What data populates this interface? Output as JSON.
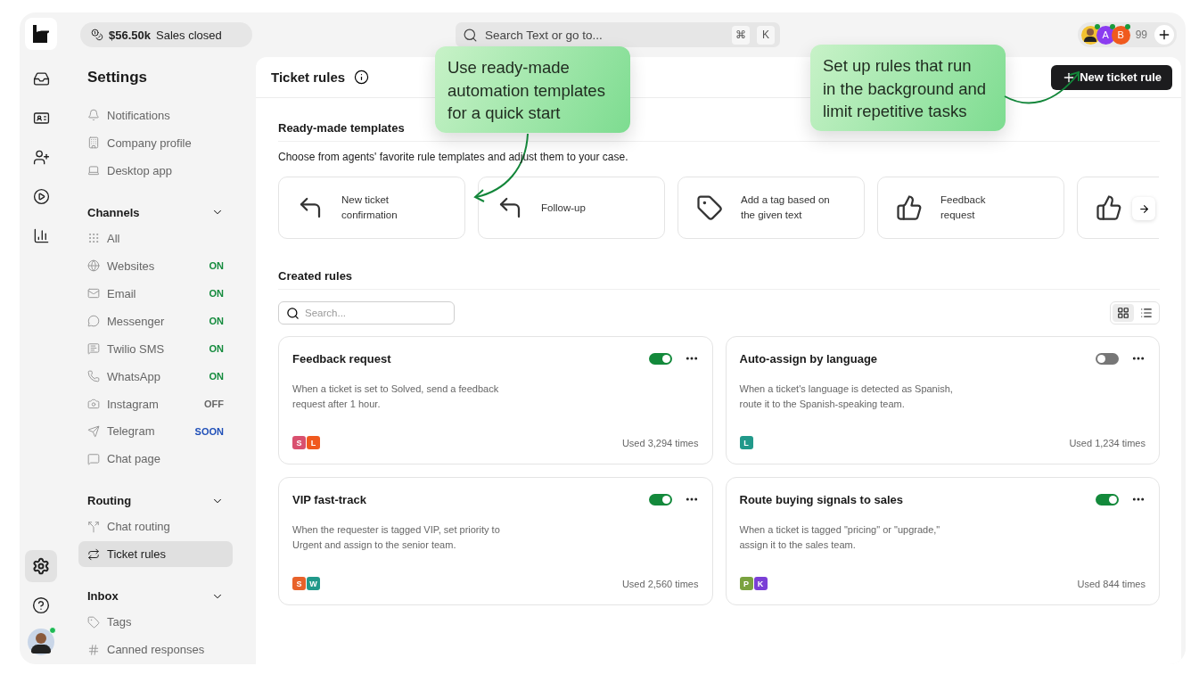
{
  "rail": {
    "items": [
      {
        "kind": "inbox",
        "selected": false
      },
      {
        "kind": "contact",
        "selected": false
      },
      {
        "kind": "team",
        "selected": false
      },
      {
        "kind": "play",
        "selected": false
      },
      {
        "kind": "chart",
        "selected": false
      }
    ],
    "bottom": [
      {
        "kind": "settings",
        "selected": true
      },
      {
        "kind": "help",
        "selected": false
      }
    ],
    "user": {
      "online": true
    }
  },
  "sales": {
    "amount": "$56.50k",
    "label": "Sales closed"
  },
  "search": {
    "placeholder": "Search Text or go to...",
    "keys": [
      "⌘",
      "K"
    ]
  },
  "team": {
    "avatars": [
      {
        "kind": "photo",
        "online": true
      },
      {
        "kind": "letter",
        "letter": "A",
        "color": "#8b3cf0",
        "online": true
      },
      {
        "kind": "letter",
        "letter": "B",
        "color": "#f05a1e",
        "online": true
      }
    ],
    "count": "99"
  },
  "sidebar": {
    "title": "Settings",
    "items": [
      {
        "kind": "bell",
        "label": "Notifications",
        "selected": false
      },
      {
        "kind": "building",
        "label": "Company profile",
        "selected": false
      },
      {
        "kind": "laptop",
        "label": "Desktop app",
        "selected": false
      }
    ],
    "sections": [
      {
        "title": "Channels",
        "expanded": true,
        "items": [
          {
            "kind": "grid",
            "label": "All",
            "selected": false
          },
          {
            "kind": "globe",
            "label": "Websites",
            "status": {
              "label": "ON",
              "color": "#138a3c"
            },
            "selected": false
          },
          {
            "kind": "mail",
            "label": "Email",
            "status": {
              "label": "ON",
              "color": "#138a3c"
            },
            "selected": false
          },
          {
            "kind": "messenger",
            "label": "Messenger",
            "status": {
              "label": "ON",
              "color": "#138a3c"
            },
            "selected": false
          },
          {
            "kind": "sms",
            "label": "Twilio SMS",
            "status": {
              "label": "ON",
              "color": "#138a3c"
            },
            "selected": false
          },
          {
            "kind": "phone",
            "label": "WhatsApp",
            "status": {
              "label": "ON",
              "color": "#138a3c"
            },
            "selected": false
          },
          {
            "kind": "camera",
            "label": "Instagram",
            "status": {
              "label": "OFF",
              "color": "#666666"
            },
            "selected": false
          },
          {
            "kind": "send",
            "label": "Telegram",
            "status": {
              "label": "SOON",
              "color": "#1f4fb8"
            },
            "selected": false
          },
          {
            "kind": "chat",
            "label": "Chat page",
            "selected": false
          }
        ]
      },
      {
        "title": "Routing",
        "expanded": true,
        "items": [
          {
            "kind": "split",
            "label": "Chat routing",
            "selected": false
          },
          {
            "kind": "rules",
            "label": "Ticket rules",
            "selected": true
          }
        ]
      },
      {
        "title": "Inbox",
        "expanded": true,
        "items": [
          {
            "kind": "tag",
            "label": "Tags",
            "selected": false
          },
          {
            "kind": "hash",
            "label": "Canned responses",
            "selected": false
          }
        ]
      }
    ]
  },
  "main": {
    "title": "Ticket rules",
    "new_button": "New ticket rule",
    "templates": {
      "title": "Ready-made templates",
      "description": "Choose from agents' favorite rule templates and adjust them to your case.",
      "items": [
        {
          "kind": "reply",
          "label": "New ticket confirmation"
        },
        {
          "kind": "reply",
          "label": "Follow-up"
        },
        {
          "kind": "tag",
          "label": "Add a tag based on the given text"
        },
        {
          "kind": "thumb",
          "label": "Feedback request"
        },
        {
          "kind": "thumb"
        }
      ]
    },
    "created": {
      "title": "Created rules",
      "search_placeholder": "Search...",
      "views": [
        {
          "kind": "grid",
          "selected": true
        },
        {
          "kind": "list",
          "selected": false
        }
      ],
      "rules": [
        {
          "title": "Feedback request",
          "on": true,
          "description": "When a ticket is set to Solved, send a feedback request after 1 hour.",
          "tags": [
            {
              "letter": "S",
              "color": "#d9506f"
            },
            {
              "letter": "L",
              "color": "#f0591e"
            }
          ],
          "usage": "Used 3,294 times"
        },
        {
          "title": "Auto-assign by language",
          "on": false,
          "description": "When a ticket's language is detected as Spanish, route it to the Spanish-speaking team.",
          "tags": [
            {
              "letter": "L",
              "color": "#21998a"
            }
          ],
          "usage": "Used 1,234 times"
        },
        {
          "title": "VIP fast-track",
          "on": true,
          "description": "When the requester is tagged VIP, set priority to Urgent and assign to the senior team.",
          "tags": [
            {
              "letter": "S",
              "color": "#e8622a"
            },
            {
              "letter": "W",
              "color": "#21998a"
            }
          ],
          "usage": "Used 2,560 times"
        },
        {
          "title": "Route buying signals to sales",
          "on": true,
          "description": "When a ticket is tagged \"pricing\" or \"upgrade,\" assign it to the sales team.",
          "tags": [
            {
              "letter": "P",
              "color": "#7aa23f"
            },
            {
              "letter": "K",
              "color": "#7b3fd6"
            }
          ],
          "usage": "Used 844 times"
        }
      ]
    }
  },
  "callouts": [
    {
      "text": "Use ready-made automation templates for a quick start"
    },
    {
      "text": "Set up rules that run in the background and limit repetitive tasks"
    }
  ]
}
